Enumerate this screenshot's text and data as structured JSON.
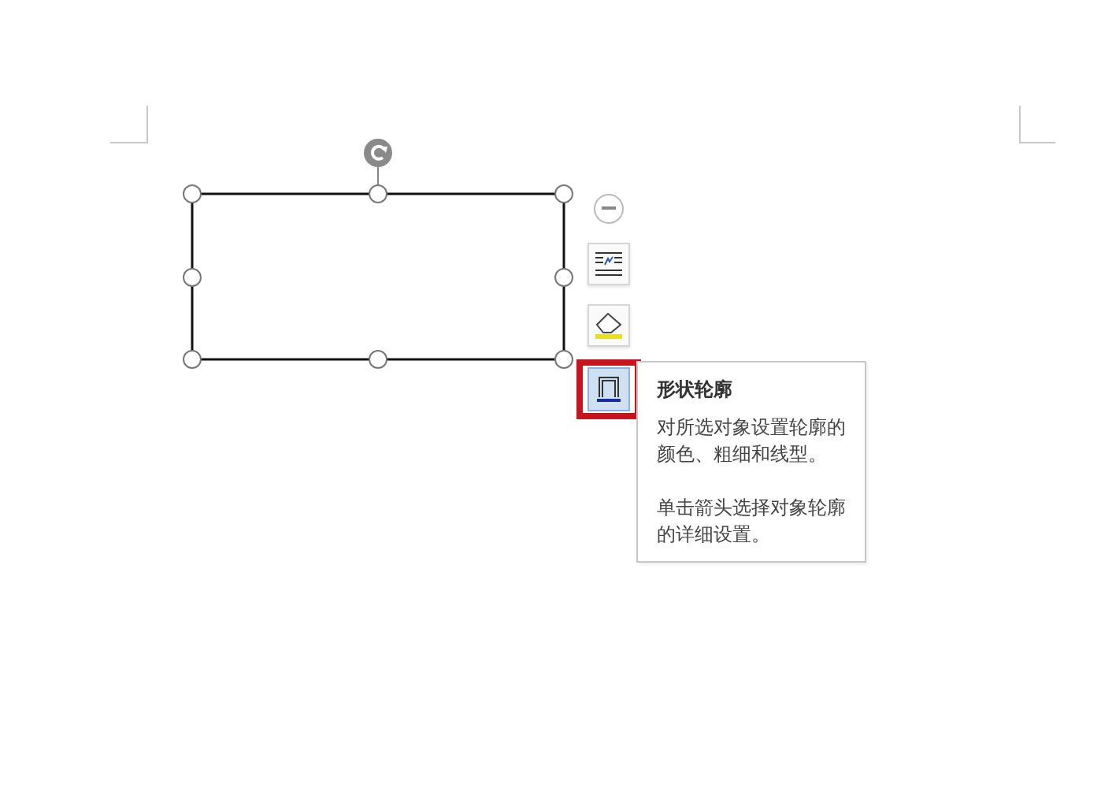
{
  "toolbar": {
    "buttons": [
      {
        "kind": "collapse",
        "selected": false
      },
      {
        "kind": "wrap",
        "selected": false
      },
      {
        "kind": "fill",
        "selected": false
      },
      {
        "kind": "outline",
        "selected": true
      }
    ]
  },
  "tooltip": {
    "title": "形状轮廓",
    "paragraphs": [
      "对所选对象设置轮廓的颜色、粗细和线型。",
      "单击箭头选择对象轮廓的详细设置。"
    ]
  }
}
